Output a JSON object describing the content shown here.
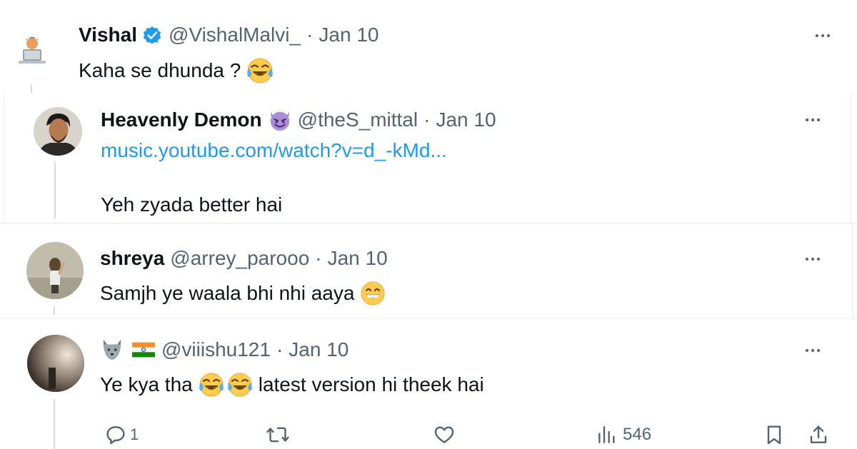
{
  "tweets": [
    {
      "name": "Vishal",
      "verified": true,
      "handle": "@VishalMalvi_",
      "separator": "·",
      "date": "Jan 10",
      "text": "Kaha se dhunda ?",
      "text_emoji": "face-with-tears-of-joy"
    },
    {
      "name": "Heavenly Demon",
      "name_emoji": "smiling-face-with-horns",
      "handle": "@theS_mittal",
      "separator": "·",
      "date": "Jan 10",
      "link": "music.youtube.com/watch?v=d_-kMd...",
      "text": "Yeh zyada better hai"
    },
    {
      "name": "shreya",
      "handle": "@arrey_parooo",
      "separator": "·",
      "date": "Jan 10",
      "text": "Samjh ye waala bhi nhi aaya",
      "text_emoji": "grinning-face-with-smiling-eyes"
    },
    {
      "name_emojis": [
        "wolf-face",
        "flag-india"
      ],
      "handle": "@viiishu121",
      "separator": "·",
      "date": "Jan 10",
      "text_before": "Ye kya tha",
      "text_emojis": [
        "face-with-tears-of-joy",
        "face-with-tears-of-joy"
      ],
      "text_after": "latest version hi theek hai",
      "actions": {
        "reply_count": "1",
        "repost_count": "",
        "like_count": "",
        "views": "546"
      }
    }
  ],
  "colors": {
    "text_primary": "#0f1419",
    "text_secondary": "#536471",
    "link": "#1d9bf0",
    "verified": "#1d9bf0",
    "thread_line": "#d5dbe0"
  }
}
